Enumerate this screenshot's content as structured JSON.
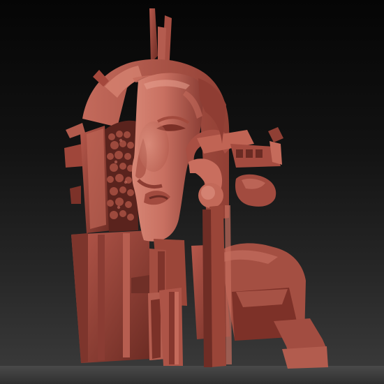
{
  "scene": {
    "subject": "clay-sculpt-bust",
    "colors": {
      "background_top": "#050505",
      "background_bottom": "#3c3c3c",
      "clay_base": "#b35b4d",
      "clay_light": "#d88373",
      "clay_dark": "#6f2f27",
      "clay_shadow": "#4b1e19"
    }
  }
}
